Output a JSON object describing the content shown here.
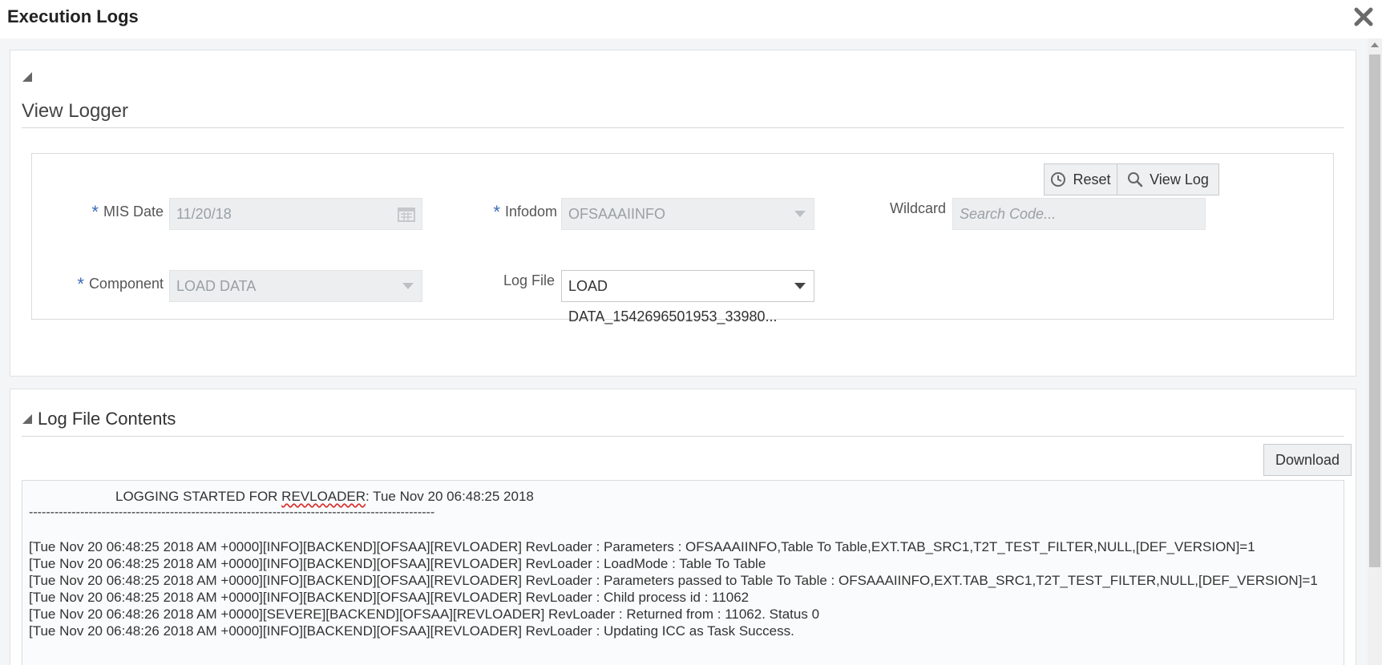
{
  "window": {
    "title": "Execution Logs",
    "close_icon": "close-icon"
  },
  "view_logger": {
    "title": "View Logger",
    "buttons": {
      "reset": "Reset",
      "view_log": "View Log"
    },
    "fields": {
      "mis_date": {
        "label": "MIS Date",
        "required": "*",
        "value": "11/20/18"
      },
      "infodom": {
        "label": "Infodom",
        "required": "*",
        "value": "OFSAAAIINFO"
      },
      "wildcard": {
        "label": "Wildcard",
        "placeholder": "Search Code..."
      },
      "component": {
        "label": "Component",
        "required": "*",
        "value": "LOAD DATA"
      },
      "log_file": {
        "label": "Log File",
        "value": "LOAD DATA_1542696501953_33980..."
      }
    }
  },
  "log_contents": {
    "title": "Log File Contents",
    "download_label": "Download",
    "header_prefix": "LOGGING STARTED FOR ",
    "header_word": "REVLOADER",
    "header_suffix": ": Tue Nov 20 06:48:25 2018",
    "separator": "-----------------------------------------------------------------------------------------------",
    "lines": [
      "[Tue Nov 20 06:48:25 2018 AM +0000][INFO][BACKEND][OFSAA][REVLOADER] RevLoader : Parameters : OFSAAAIINFO,Table To Table,EXT.TAB_SRC1,T2T_TEST_FILTER,NULL,[DEF_VERSION]=1",
      "[Tue Nov 20 06:48:25 2018 AM +0000][INFO][BACKEND][OFSAA][REVLOADER] RevLoader : LoadMode : Table To Table",
      "[Tue Nov 20 06:48:25 2018 AM +0000][INFO][BACKEND][OFSAA][REVLOADER] RevLoader : Parameters passed to Table To Table : OFSAAAIINFO,EXT.TAB_SRC1,T2T_TEST_FILTER,NULL,[DEF_VERSION]=1",
      "[Tue Nov 20 06:48:25 2018 AM +0000][INFO][BACKEND][OFSAA][REVLOADER] RevLoader : Child process id : 11062",
      "[Tue Nov 20 06:48:26 2018 AM +0000][SEVERE][BACKEND][OFSAA][REVLOADER] RevLoader : Returned from : 11062. Status 0",
      "[Tue Nov 20 06:48:26 2018 AM +0000][INFO][BACKEND][OFSAA][REVLOADER] RevLoader : Updating ICC as Task Success."
    ]
  }
}
